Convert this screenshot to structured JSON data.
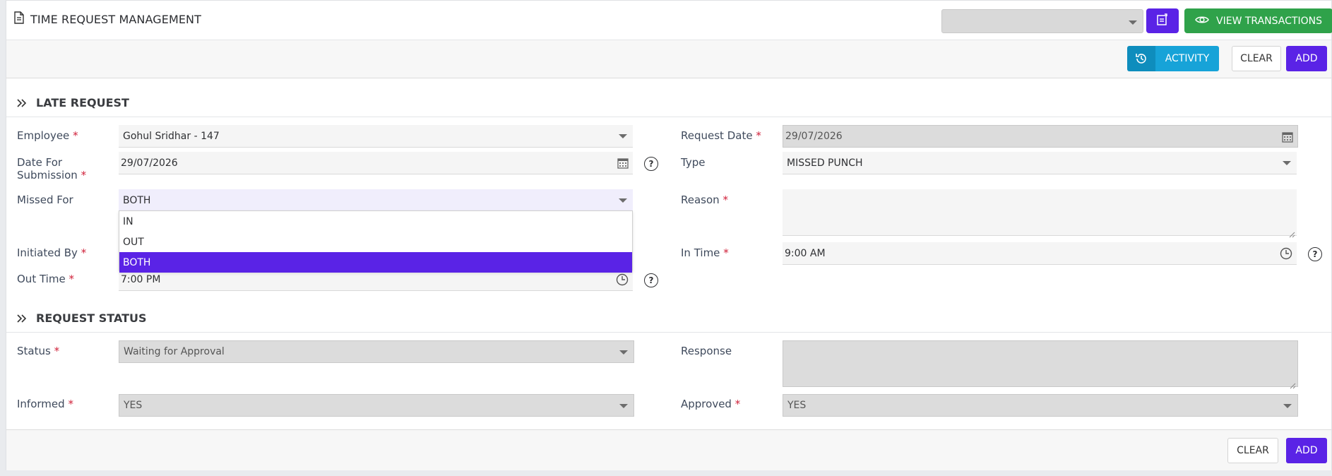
{
  "header": {
    "title": "TIME REQUEST MANAGEMENT",
    "top_select_value": "",
    "view_transactions_label": "VIEW TRANSACTIONS"
  },
  "toolbar": {
    "activity_label": "ACTIVITY",
    "clear_label": "CLEAR",
    "add_label": "ADD"
  },
  "late_request": {
    "title": "LATE REQUEST",
    "employee": {
      "label": "Employee",
      "value": "Gohul Sridhar - 147"
    },
    "date_for_submission": {
      "label_line1": "Date For",
      "label_line2": "Submission",
      "value": "29/07/2026"
    },
    "missed_for": {
      "label": "Missed For",
      "value": "BOTH",
      "options": [
        "IN",
        "OUT",
        "BOTH"
      ],
      "selected": "BOTH"
    },
    "initiated_by": {
      "label": "Initiated By"
    },
    "out_time": {
      "label": "Out Time",
      "value": "7:00 PM"
    },
    "request_date": {
      "label": "Request Date",
      "value": "29/07/2026"
    },
    "type": {
      "label": "Type",
      "value": "MISSED PUNCH"
    },
    "reason": {
      "label": "Reason",
      "value": ""
    },
    "in_time": {
      "label": "In Time",
      "value": "9:00 AM"
    },
    "required_mark": "*",
    "help_glyph": "?"
  },
  "request_status": {
    "title": "REQUEST STATUS",
    "status": {
      "label": "Status",
      "value": "Waiting for Approval"
    },
    "informed": {
      "label": "Informed",
      "value": "YES"
    },
    "response": {
      "label": "Response",
      "value": ""
    },
    "approved": {
      "label": "Approved",
      "value": "YES"
    }
  },
  "footer": {
    "clear_label": "CLEAR",
    "add_label": "ADD"
  },
  "colors": {
    "primary": "#5a23e6",
    "success": "#2fa24a",
    "info": "#17a3d8",
    "required": "#d0213a"
  },
  "icons": [
    "document-icon",
    "caret-down-icon",
    "note-edit-icon",
    "eye-icon",
    "history-icon",
    "double-chevron-right-icon",
    "calendar-icon",
    "clock-icon",
    "help-circle-icon"
  ]
}
